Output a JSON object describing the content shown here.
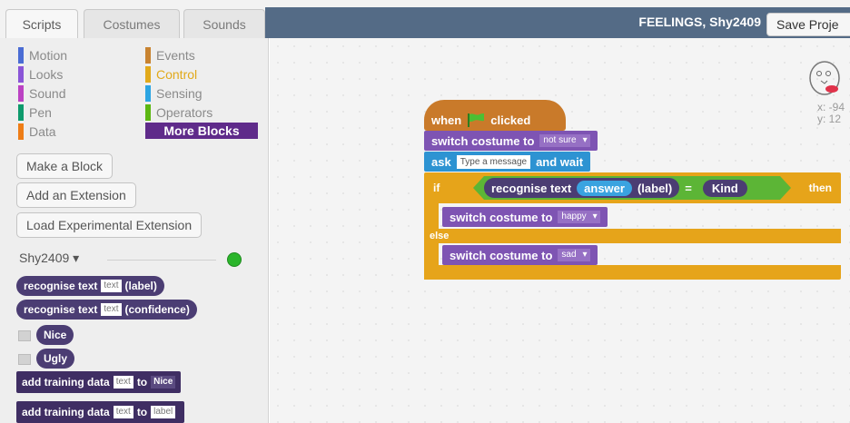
{
  "tabs": [
    {
      "label": "Scripts"
    },
    {
      "label": "Costumes"
    },
    {
      "label": "Sounds"
    }
  ],
  "header": {
    "project_title": "FEELINGS, Shy2409",
    "save_label": "Save Proje"
  },
  "categories": [
    {
      "label": "Motion",
      "color": "#4a6cd4"
    },
    {
      "label": "Looks",
      "color": "#8a55d7"
    },
    {
      "label": "Sound",
      "color": "#bb42c3"
    },
    {
      "label": "Pen",
      "color": "#0e9a6c"
    },
    {
      "label": "Data",
      "color": "#ee7d16"
    },
    {
      "label": "Events",
      "color": "#c88330"
    },
    {
      "label": "Control",
      "color": "#e1a91a"
    },
    {
      "label": "Sensing",
      "color": "#2ca5e2"
    },
    {
      "label": "Operators",
      "color": "#5cb712"
    },
    {
      "label": "More Blocks",
      "color": "#632d99"
    }
  ],
  "palette_buttons": {
    "make_block": "Make a Block",
    "add_extension": "Add an Extension",
    "load_experimental": "Load Experimental Extension"
  },
  "model": {
    "name": "Shy2409",
    "dropdown_glyph": "▾"
  },
  "palette_blocks": {
    "recognise_label": {
      "prefix": "recognise text",
      "slot": "text",
      "suffix": "(label)"
    },
    "recognise_conf": {
      "prefix": "recognise text",
      "slot": "text",
      "suffix": "(confidence)"
    },
    "label_nice": "Nice",
    "label_ugly": "Ugly",
    "add_training_nice": {
      "prefix": "add training data",
      "slot": "text",
      "to": "to",
      "target": "Nice"
    },
    "add_training_label": {
      "prefix": "add training data",
      "slot": "text",
      "to": "to",
      "target": "label"
    }
  },
  "script": {
    "when": "when",
    "clicked": "clicked",
    "switch_costume": "switch costume to",
    "costume_not_sure": "not sure",
    "ask": "ask",
    "ask_placeholder": "Type a message",
    "and_wait": "and wait",
    "if": "if",
    "recognise_text": "recognise text",
    "answer": "answer",
    "label_paren": "(label)",
    "equals": "=",
    "kind": "Kind",
    "then": "then",
    "costume_happy": "happy",
    "else": "else",
    "costume_sad": "sad"
  },
  "sprite": {
    "x": "x: -94",
    "y": "y: 12"
  }
}
